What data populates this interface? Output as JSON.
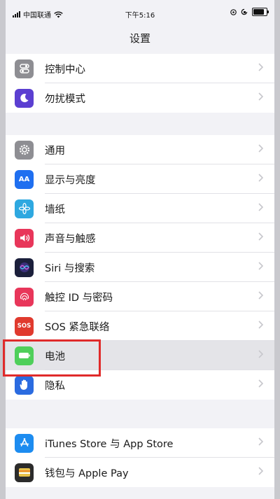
{
  "status_bar": {
    "carrier": "中国联通",
    "time": "下午5:16"
  },
  "nav": {
    "title": "设置"
  },
  "group1": [
    {
      "label": "控制中心",
      "icon": "control-center-icon",
      "color": "#8e8e93"
    },
    {
      "label": "勿扰模式",
      "icon": "moon-icon",
      "color": "#5b3fd1"
    }
  ],
  "group2": [
    {
      "label": "通用",
      "icon": "gear-icon",
      "color": "#8e8e93"
    },
    {
      "label": "显示与亮度",
      "icon": "text-size-icon",
      "color": "#1f6ff0",
      "icon_text": "AA"
    },
    {
      "label": "墙纸",
      "icon": "wallpaper-flower-icon",
      "color": "#2ea8e0"
    },
    {
      "label": "声音与触感",
      "icon": "speaker-icon",
      "color": "#e8365a"
    },
    {
      "label": "Siri 与搜索",
      "icon": "siri-icon",
      "color": "#1b1f3b"
    },
    {
      "label": "触控 ID 与密码",
      "icon": "fingerprint-icon",
      "color": "#e8365a"
    },
    {
      "label": "SOS 紧急联络",
      "icon": "sos-icon",
      "color": "#e03a2e",
      "icon_text": "SOS"
    },
    {
      "label": "电池",
      "icon": "battery-icon",
      "color": "#4fcf5a",
      "highlighted": true
    },
    {
      "label": "隐私",
      "icon": "hand-icon",
      "color": "#2b6be0"
    }
  ],
  "group3": [
    {
      "label": "iTunes Store 与 App Store",
      "icon": "app-store-icon",
      "color": "#1d8cf0"
    },
    {
      "label": "钱包与 Apple Pay",
      "icon": "wallet-icon",
      "color": "#2b2b2b"
    }
  ],
  "colors": {
    "background": "#f2f2f6",
    "highlight_box": "#e02a2a"
  }
}
